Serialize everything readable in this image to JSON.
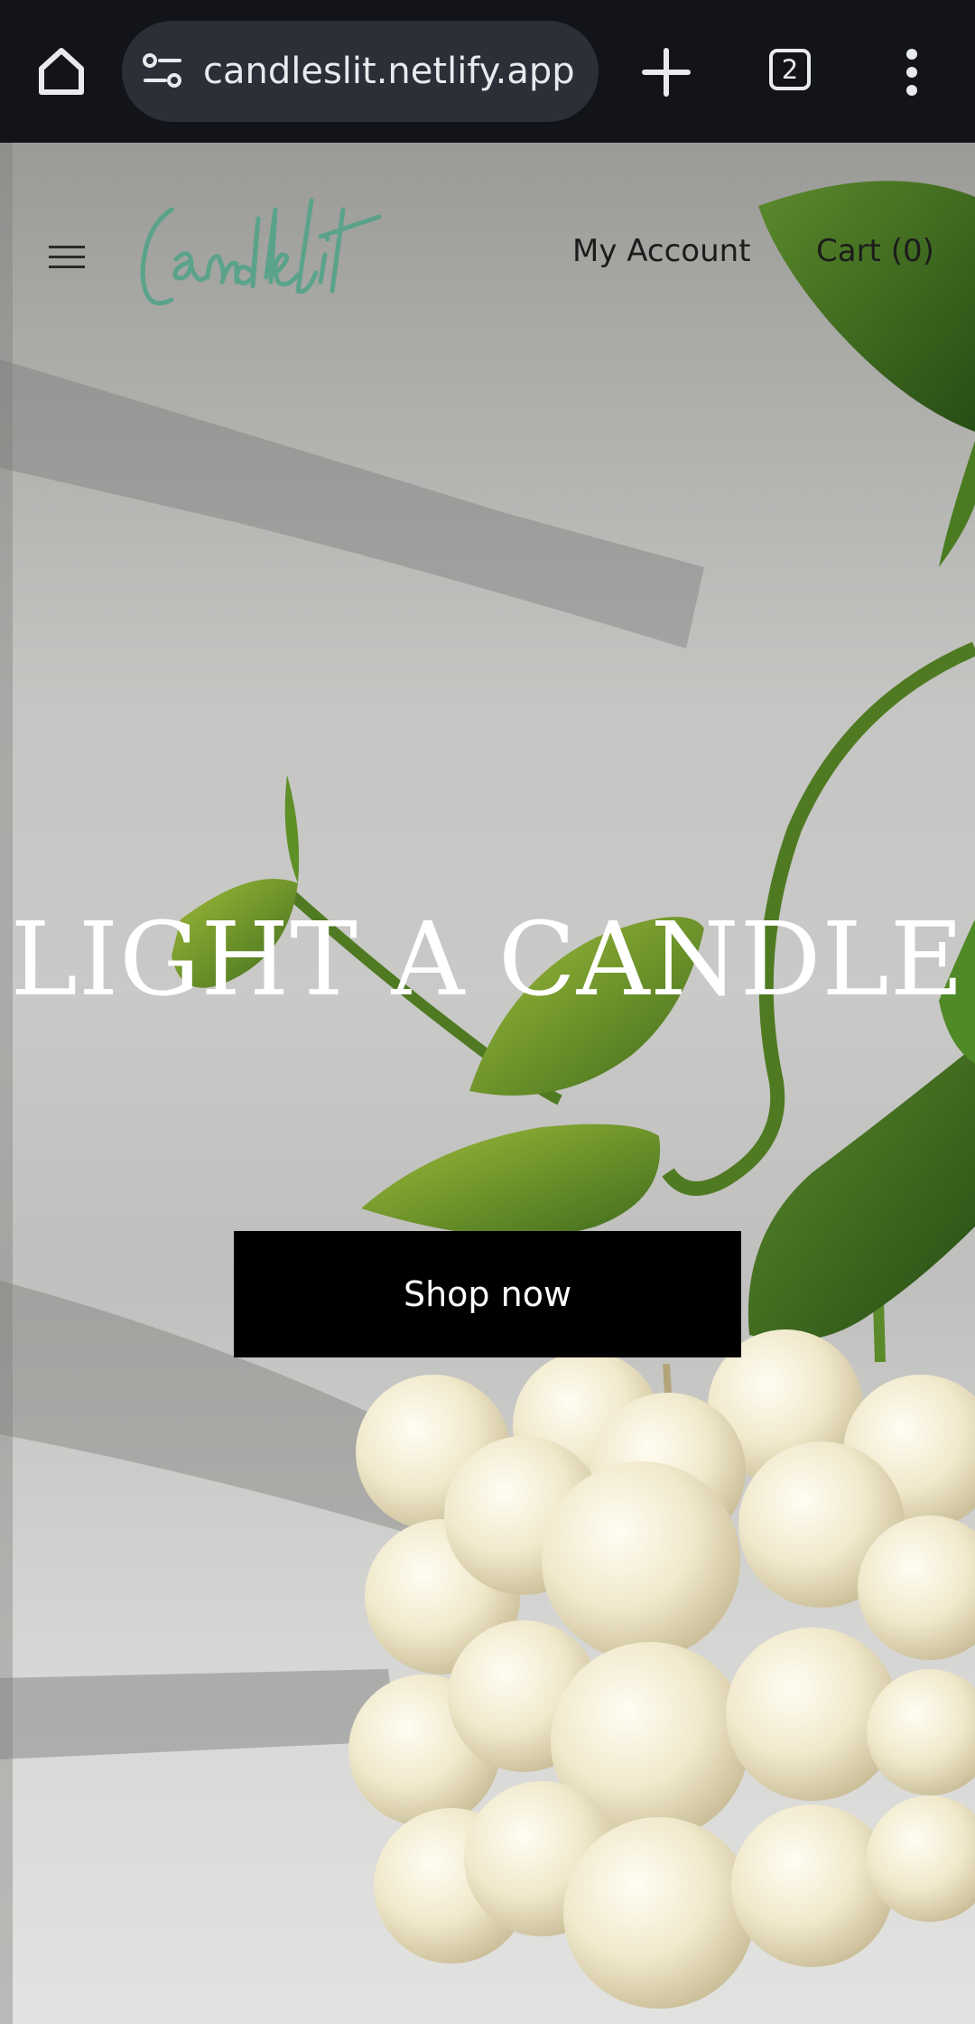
{
  "browser": {
    "url": "candleslit.netlify.app",
    "tab_count": "2"
  },
  "site": {
    "logo_text": "Candlelit",
    "nav": {
      "account": "My Account",
      "cart": "Cart (0)"
    },
    "hero": {
      "title": "LIGHT A CANDLE",
      "cta": "Shop now"
    }
  },
  "colors": {
    "logo": "#5aa38a",
    "chrome_bg": "#12141a",
    "url_pill": "#2b2f38"
  }
}
